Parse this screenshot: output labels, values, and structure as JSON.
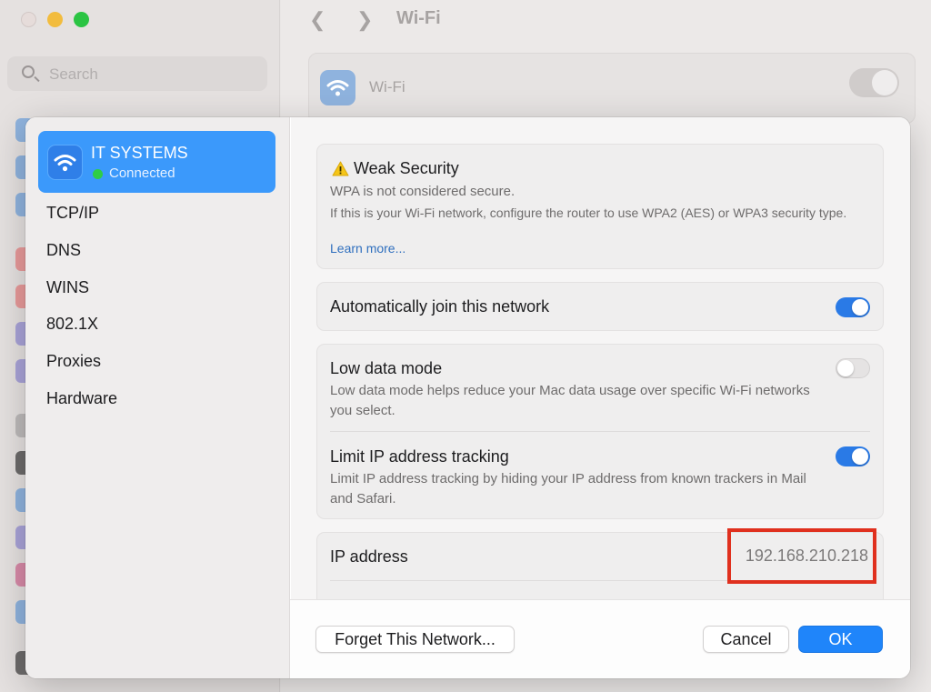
{
  "window": {
    "title": "Wi-Fi",
    "search_placeholder": "Search",
    "wifi_label": "Wi-Fi",
    "wifi_enabled": true
  },
  "sidebar": {
    "network": {
      "name": "IT SYSTEMS",
      "status": "Connected"
    },
    "items": [
      {
        "label": "TCP/IP"
      },
      {
        "label": "DNS"
      },
      {
        "label": "WINS"
      },
      {
        "label": "802.1X"
      },
      {
        "label": "Proxies"
      },
      {
        "label": "Hardware"
      }
    ]
  },
  "security": {
    "title": "Weak Security",
    "subtitle": "WPA is not considered secure.",
    "description": "If this is your Wi-Fi network, configure the router to use WPA2 (AES) or WPA3 security type.",
    "link": "Learn more..."
  },
  "settings": {
    "auto_join": {
      "label": "Automatically join this network",
      "enabled": true
    },
    "low_data": {
      "label": "Low data mode",
      "description": "Low data mode helps reduce your Mac data usage over specific Wi-Fi networks you select.",
      "enabled": false
    },
    "limit_ip": {
      "label": "Limit IP address tracking",
      "description": "Limit IP address tracking by hiding your IP address from known trackers in Mail and Safari.",
      "enabled": true
    },
    "ip_address": {
      "label": "IP address",
      "value": "192.168.210.218"
    }
  },
  "buttons": {
    "forget": "Forget This Network...",
    "cancel": "Cancel",
    "ok": "OK"
  },
  "colors": {
    "accent": "#3b99fb",
    "toggle_on": "#2a7ae6",
    "highlight": "#e0301e",
    "connected": "#2fcd46"
  }
}
